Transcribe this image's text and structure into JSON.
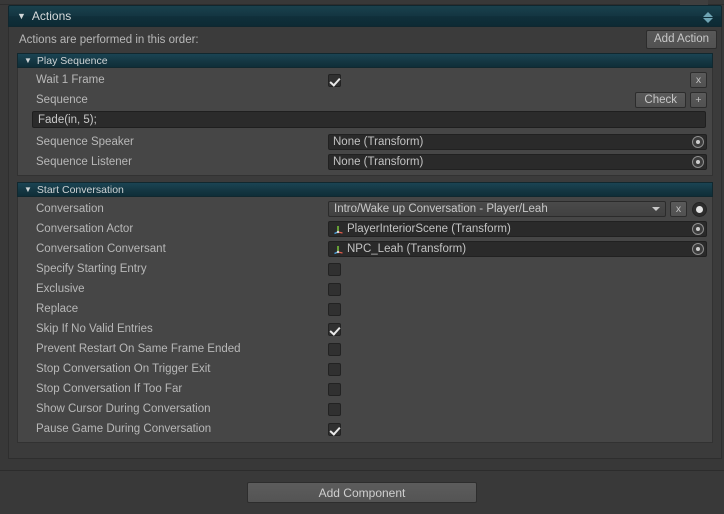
{
  "window": {
    "component_title": "Actions",
    "scroll_up_icon": "triangle-up-icon",
    "scroll_down_icon": "triangle-down-icon"
  },
  "actions_panel": {
    "order_caption": "Actions are performed in this order:",
    "add_action_label": "Add Action"
  },
  "play_sequence": {
    "title": "Play Sequence",
    "rows": [
      {
        "label": "Wait 1 Frame",
        "type": "checkbox",
        "checked": true,
        "remove_label": "x"
      },
      {
        "label": "Sequence",
        "type": "buttons",
        "check_label": "Check",
        "plus_label": "+"
      }
    ],
    "sequence_value": "Fade(in, 5);",
    "object_rows": [
      {
        "label": "Sequence Speaker",
        "value": "None (Transform)"
      },
      {
        "label": "Sequence Listener",
        "value": "None (Transform)"
      }
    ]
  },
  "start_conversation": {
    "title": "Start Conversation",
    "conversation": {
      "label": "Conversation",
      "value": "Intro/Wake up Conversation - Player/Leah",
      "clear_label": "x",
      "picker_icon": "object-picker-icon"
    },
    "object_rows": [
      {
        "label": "Conversation Actor",
        "value": "PlayerInteriorScene (Transform)",
        "icon": "transform-gizmo-icon"
      },
      {
        "label": "Conversation Conversant",
        "value": "NPC_Leah (Transform)",
        "icon": "transform-gizmo-icon"
      }
    ],
    "toggles": [
      {
        "label": "Specify Starting Entry",
        "checked": false
      },
      {
        "label": "Exclusive",
        "checked": false
      },
      {
        "label": "Replace",
        "checked": false
      },
      {
        "label": "Skip If No Valid Entries",
        "checked": true
      },
      {
        "label": "Prevent Restart On Same Frame Ended",
        "checked": false
      },
      {
        "label": "Stop Conversation On Trigger Exit",
        "checked": false
      },
      {
        "label": "Stop Conversation If Too Far",
        "checked": false
      },
      {
        "label": "Show Cursor During Conversation",
        "checked": false
      },
      {
        "label": "Pause Game During Conversation",
        "checked": true
      }
    ]
  },
  "footer": {
    "add_component_label": "Add Component"
  },
  "colors": {
    "header_teal": "#143642",
    "panel_bg": "#3b3b3b",
    "section_bg": "#464646",
    "text": "#b8b8b8",
    "field_bg": "#2a2a2a"
  }
}
